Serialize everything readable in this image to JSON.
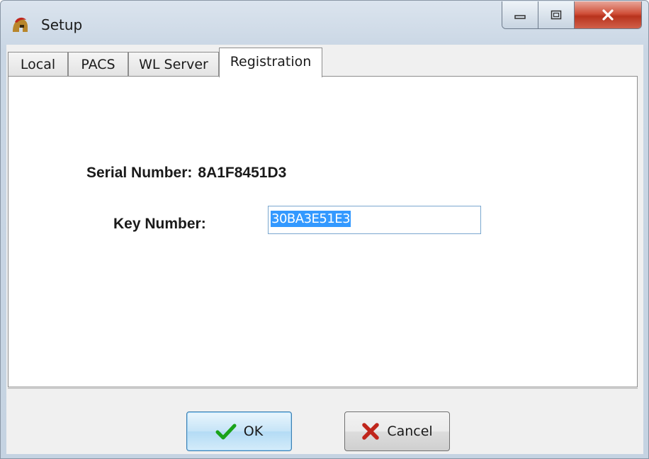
{
  "window": {
    "title": "Setup"
  },
  "tabs": [
    {
      "label": "Local"
    },
    {
      "label": "PACS"
    },
    {
      "label": "WL Server"
    },
    {
      "label": "Registration",
      "active": true
    }
  ],
  "registration": {
    "serial_label": "Serial Number:",
    "serial_value": "8A1F8451D3",
    "key_label": "Key Number:",
    "key_value": "30BA3E51E3"
  },
  "buttons": {
    "ok_label": "OK",
    "cancel_label": "Cancel"
  },
  "icons": {
    "app": "spartan-helmet-icon",
    "ok": "checkmark-icon",
    "cancel": "x-icon"
  },
  "colors": {
    "selection": "#3399ff",
    "close_button": "#c7402a",
    "ok_check": "#1aa31a",
    "cancel_x": "#c0261c"
  }
}
